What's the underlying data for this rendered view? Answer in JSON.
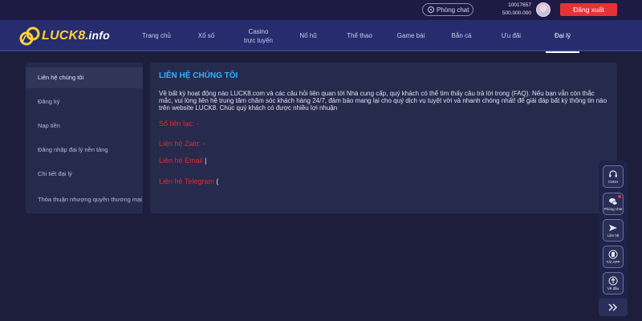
{
  "topbar": {
    "chat_label": "Phòng chat",
    "user_id": "10017657",
    "balance": "500.000.000",
    "logout_label": "Đăng xuất"
  },
  "logo": {
    "brand": "LUCK8",
    "suffix": ".info",
    "primary_color": "#ffd234"
  },
  "nav": {
    "items": [
      {
        "label": "Trang chủ"
      },
      {
        "label": "Xổ số"
      },
      {
        "label": "Casino",
        "label2": "trực tuyến"
      },
      {
        "label": "Nổ hũ"
      },
      {
        "label": "Thể thao"
      },
      {
        "label": "Game bài"
      },
      {
        "label": "Bắn cá"
      },
      {
        "label": "Ưu đãi"
      },
      {
        "label": "Đại lý",
        "active": true
      }
    ]
  },
  "sidebar": {
    "items": [
      {
        "label": "Liên hệ chúng tôi",
        "active": true
      },
      {
        "label": "Đăng ký"
      },
      {
        "label": "Nạp tiền"
      },
      {
        "label": "Đăng nhập đại lý nền tảng"
      },
      {
        "label": "Chi tiết đại lý"
      },
      {
        "label": "Thỏa thuận nhượng quyền thương mại"
      }
    ]
  },
  "content": {
    "title": "LIÊN HỆ CHÚNG TÔI",
    "body": "Về bất kỳ hoạt động nào LUCK8.com và các câu hỏi liên quan tới Nhà cung cấp, quý khách có thể tìm thấy câu trả lời trong (FAQ). Nếu bạn vẫn còn thắc mắc, vui lòng liên hệ trung tâm chăm sóc khách hàng 24/7, đảm bảo mang lại cho quý dịch vụ tuyệt vời và nhanh chóng nhất! để giải đáp bất kỳ thông tin nào trên website LUCK8. Chúc quý khách có được nhiều lợi nhuận",
    "contacts": [
      {
        "label": "Số liên lạc:",
        "value": "-"
      },
      {
        "label": "Liên hệ Zalo:",
        "value": "-"
      },
      {
        "label": "Liên hệ Email",
        "value": "|"
      },
      {
        "label": "Liên hệ Telegram",
        "value": "("
      }
    ],
    "title_color": "#2eb4ff",
    "contact_color": "#e6282e"
  },
  "float_panel": {
    "buttons": [
      {
        "label": "CSKH",
        "icon": "headset-icon"
      },
      {
        "label": "Phòng chat",
        "icon": "chat-bubbles-icon",
        "badge": true
      },
      {
        "label": "Liên hệ",
        "icon": "send-icon"
      },
      {
        "label": "TẢI APP",
        "icon": "phone-icon"
      },
      {
        "label": "Về đầu",
        "icon": "arrow-up-icon"
      }
    ],
    "collapse_icon": "double-chevron-right-icon"
  },
  "colors": {
    "page_bg": "#1c1e3c",
    "navbar_bg": "#272c6e",
    "logout_bg": "#e53238"
  }
}
